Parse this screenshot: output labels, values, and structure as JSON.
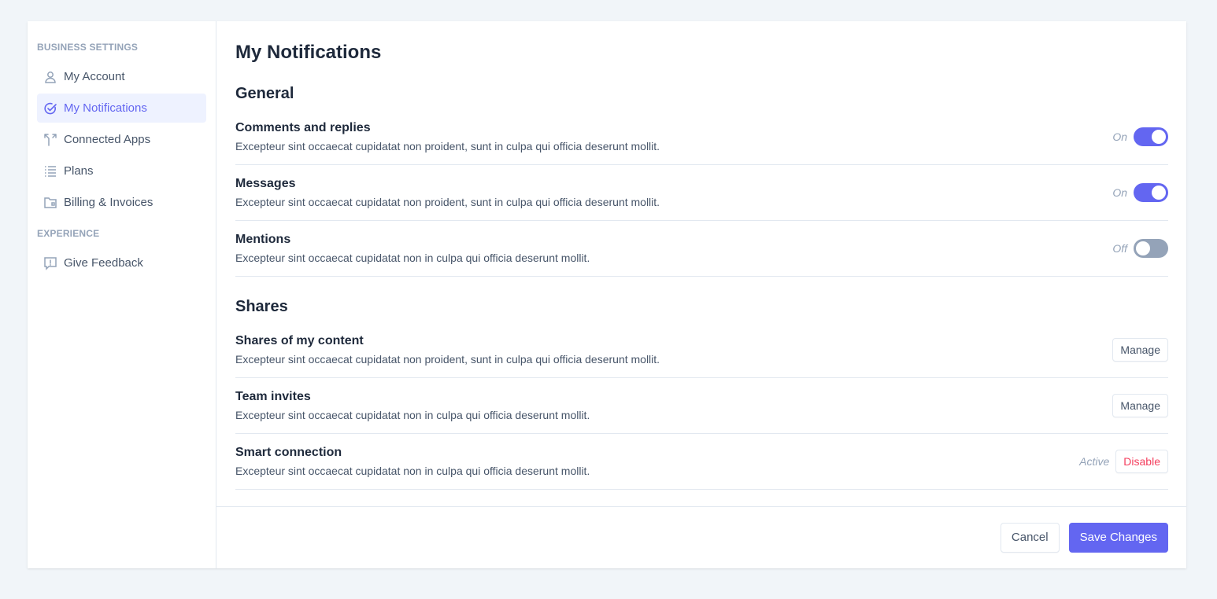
{
  "colors": {
    "accent": "#6366f1",
    "toggle_off": "#94a3b8",
    "danger": "#f43f5e",
    "active_bg": "#eef2ff"
  },
  "sidebar": {
    "sections": [
      {
        "label": "Business settings",
        "items": [
          {
            "label": "My Account",
            "icon": "user-icon",
            "active": false
          },
          {
            "label": "My Notifications",
            "icon": "check-circle-icon",
            "active": true
          },
          {
            "label": "Connected Apps",
            "icon": "branch-arrows-icon",
            "active": false
          },
          {
            "label": "Plans",
            "icon": "list-icon",
            "active": false
          },
          {
            "label": "Billing & Invoices",
            "icon": "folder-icon",
            "active": false
          }
        ]
      },
      {
        "label": "Experience",
        "items": [
          {
            "label": "Give Feedback",
            "icon": "feedback-icon",
            "active": false
          }
        ]
      }
    ]
  },
  "main": {
    "title": "My Notifications",
    "general": {
      "title": "General",
      "rows": [
        {
          "title": "Comments and replies",
          "desc": "Excepteur sint occaecat cupidatat non proident, sunt in culpa qui officia deserunt mollit.",
          "state": "On",
          "enabled": true
        },
        {
          "title": "Messages",
          "desc": "Excepteur sint occaecat cupidatat non proident, sunt in culpa qui officia deserunt mollit.",
          "state": "On",
          "enabled": true
        },
        {
          "title": "Mentions",
          "desc": "Excepteur sint occaecat cupidatat non in culpa qui officia deserunt mollit.",
          "state": "Off",
          "enabled": false
        }
      ]
    },
    "shares": {
      "title": "Shares",
      "rows": [
        {
          "title": "Shares of my content",
          "desc": "Excepteur sint occaecat cupidatat non proident, sunt in culpa qui officia deserunt mollit.",
          "button": "Manage"
        },
        {
          "title": "Team invites",
          "desc": "Excepteur sint occaecat cupidatat non in culpa qui officia deserunt mollit.",
          "button": "Manage"
        },
        {
          "title": "Smart connection",
          "desc": "Excepteur sint occaecat cupidatat non in culpa qui officia deserunt mollit.",
          "status": "Active",
          "button": "Disable"
        }
      ]
    }
  },
  "footer": {
    "cancel_label": "Cancel",
    "save_label": "Save Changes"
  }
}
